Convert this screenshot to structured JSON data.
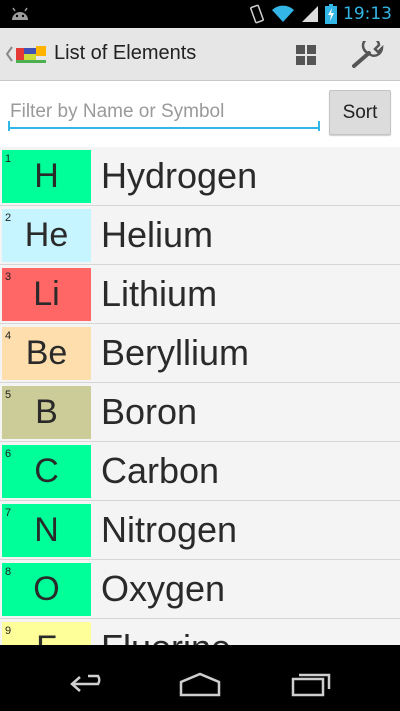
{
  "status_bar": {
    "time": "19:13",
    "icons": [
      "android-icon",
      "vibrate-icon",
      "wifi-icon",
      "signal-icon",
      "battery-charging-icon"
    ],
    "time_color": "#33b5e5"
  },
  "action_bar": {
    "title": "List of Elements",
    "icons": [
      "up-caret-icon",
      "app-logo-icon",
      "grid-view-icon",
      "wrench-settings-icon"
    ]
  },
  "filter": {
    "placeholder": "Filter by Name or Symbol",
    "value": "",
    "accent": "#33b5e5"
  },
  "sort_button": {
    "label": "Sort"
  },
  "elements": [
    {
      "number": "1",
      "symbol": "H",
      "name": "Hydrogen",
      "color": "#00ff99"
    },
    {
      "number": "2",
      "symbol": "He",
      "name": "Helium",
      "color": "#c6f4ff"
    },
    {
      "number": "3",
      "symbol": "Li",
      "name": "Lithium",
      "color": "#ff6666"
    },
    {
      "number": "4",
      "symbol": "Be",
      "name": "Beryllium",
      "color": "#ffdead"
    },
    {
      "number": "5",
      "symbol": "B",
      "name": "Boron",
      "color": "#cccc99"
    },
    {
      "number": "6",
      "symbol": "C",
      "name": "Carbon",
      "color": "#00ff99"
    },
    {
      "number": "7",
      "symbol": "N",
      "name": "Nitrogen",
      "color": "#00ff99"
    },
    {
      "number": "8",
      "symbol": "O",
      "name": "Oxygen",
      "color": "#00ff99"
    },
    {
      "number": "9",
      "symbol": "F",
      "name": "Fluorine",
      "color": "#ffff99"
    }
  ],
  "nav_bar": {
    "icons": [
      "back-icon",
      "home-icon",
      "recent-apps-icon"
    ]
  }
}
